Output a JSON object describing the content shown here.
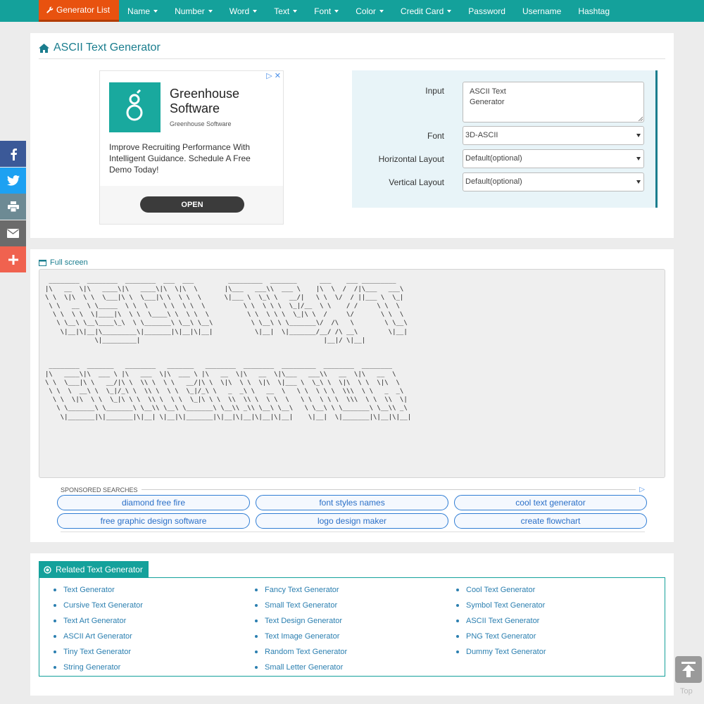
{
  "nav": {
    "items": [
      {
        "label": "Generator List",
        "dropdown": false,
        "active": true
      },
      {
        "label": "Name",
        "dropdown": true
      },
      {
        "label": "Number",
        "dropdown": true
      },
      {
        "label": "Word",
        "dropdown": true
      },
      {
        "label": "Text",
        "dropdown": true
      },
      {
        "label": "Font",
        "dropdown": true
      },
      {
        "label": "Color",
        "dropdown": true
      },
      {
        "label": "Credit Card",
        "dropdown": true
      },
      {
        "label": "Password",
        "dropdown": false
      },
      {
        "label": "Username",
        "dropdown": false
      },
      {
        "label": "Hashtag",
        "dropdown": false
      }
    ],
    "color": "#14a19b",
    "active_color": "#e8520f"
  },
  "page": {
    "title": "ASCII Text Generator"
  },
  "ad": {
    "brand_line1": "Greenhouse",
    "brand_line2": "Software",
    "brand_sub": "Greenhouse Software",
    "text": "Improve Recruiting Performance With Intelligent Guidance. Schedule A Free Demo Today!",
    "open_label": "OPEN"
  },
  "form": {
    "input_label": "Input",
    "input_line1": "ASCII Text",
    "input_line2": "Generator",
    "font_label": "Font",
    "font_value": "3D-ASCII",
    "hlayout_label": "Horizontal Layout",
    "hlayout_value": "Default(optional)",
    "vlayout_label": "Vertical Layout",
    "vlayout_value": "Default(optional)"
  },
  "output": {
    "fullscreen_label": "Full screen",
    "ascii_art": " ________  ________  ________  ___  ___         _________  _______      ___    ___ _________   \n|\\   __  \\|\\   ____\\|\\   ____\\|\\  \\|\\  \\       |\\___   ___\\\\  ___ \\    |\\  \\  /  /|\\___   ___\\ \n\\ \\  \\|\\  \\ \\  \\___|\\ \\  \\___|\\ \\  \\ \\  \\      \\|___ \\  \\_\\ \\   __/|   \\ \\  \\/  / ||___ \\  \\_| \n \\ \\   __  \\ \\_____  \\ \\  \\    \\ \\  \\ \\  \\          \\ \\  \\ \\ \\  \\_|/__  \\ \\    / /     \\ \\  \\  \n  \\ \\  \\ \\  \\|____|\\  \\ \\  \\____\\ \\  \\ \\  \\          \\ \\  \\ \\ \\  \\_|\\ \\  /     \\/       \\ \\  \\ \n   \\ \\__\\ \\__\\____\\_\\  \\ \\_______\\ \\__\\ \\__\\          \\ \\__\\ \\ \\_______\\/  /\\   \\        \\ \\__\\\n    \\|__|\\|__|\\_________\\|_______|\\|__|\\|__|           \\|__|  \\|_______/__/ /\\ __\\        \\|__|\n             \\|_________|                                                |__|/ \\|__|              \n\n\n ________  _______   ________   _______   ________  ________  _________  ________  ________     \n|\\   ____\\|\\  ___ \\ |\\   ___  \\|\\  ___ \\ |\\   __  \\|\\   __  \\|\\___   ___\\\\   __  \\|\\   __  \\    \n\\ \\  \\___|\\ \\   __/|\\ \\  \\\\ \\  \\ \\   __/|\\ \\  \\|\\  \\ \\  \\|\\  \\|___ \\  \\_\\ \\  \\|\\  \\ \\  \\|\\  \\   \n \\ \\  \\  __\\ \\  \\_|/_\\ \\  \\\\ \\  \\ \\  \\_|/_\\ \\   _  _\\ \\   __  \\   \\ \\  \\ \\ \\  \\\\\\  \\ \\   _  _\\  \n  \\ \\  \\|\\  \\ \\  \\_|\\ \\ \\  \\\\ \\  \\ \\  \\_|\\ \\ \\  \\\\  \\\\ \\  \\ \\  \\   \\ \\  \\ \\ \\  \\\\\\  \\ \\  \\\\  \\| \n   \\ \\_______\\ \\_______\\ \\__\\\\ \\__\\ \\_______\\ \\__\\\\ _\\\\ \\__\\ \\__\\   \\ \\__\\ \\ \\_______\\ \\__\\\\ _\\ \n    \\|_______|\\|_______|\\|__| \\|__|\\|_______|\\|__|\\|__|\\|__|\\|__|    \\|__|  \\|_______|\\|__|\\|__|"
  },
  "sponsored": {
    "heading": "SPONSORED SEARCHES",
    "links": [
      "diamond free fire",
      "font styles names",
      "cool text generator",
      "free graphic design software",
      "logo design maker",
      "create flowchart"
    ]
  },
  "related": {
    "title": "Related Text Generator",
    "columns": [
      [
        "Text Generator",
        "Cursive Text Generator",
        "Text Art Generator",
        "ASCII Art Generator",
        "Tiny Text Generator",
        "String Generator"
      ],
      [
        "Fancy Text Generator",
        "Small Text Generator",
        "Text Design Generator",
        "Text Image Generator",
        "Random Text Generator",
        "Small Letter Generator"
      ],
      [
        "Cool Text Generator",
        "Symbol Text Generator",
        "ASCII Text Generator",
        "PNG Text Generator",
        "Dummy Text Generator"
      ]
    ]
  },
  "social": [
    {
      "name": "facebook",
      "color": "#3b5998"
    },
    {
      "name": "twitter",
      "color": "#1da1f2"
    },
    {
      "name": "print",
      "color": "#6d8a94"
    },
    {
      "name": "email",
      "color": "#6b6b6b"
    },
    {
      "name": "share-more",
      "color": "#f0624f"
    }
  ],
  "top_button": {
    "label": "Top"
  }
}
